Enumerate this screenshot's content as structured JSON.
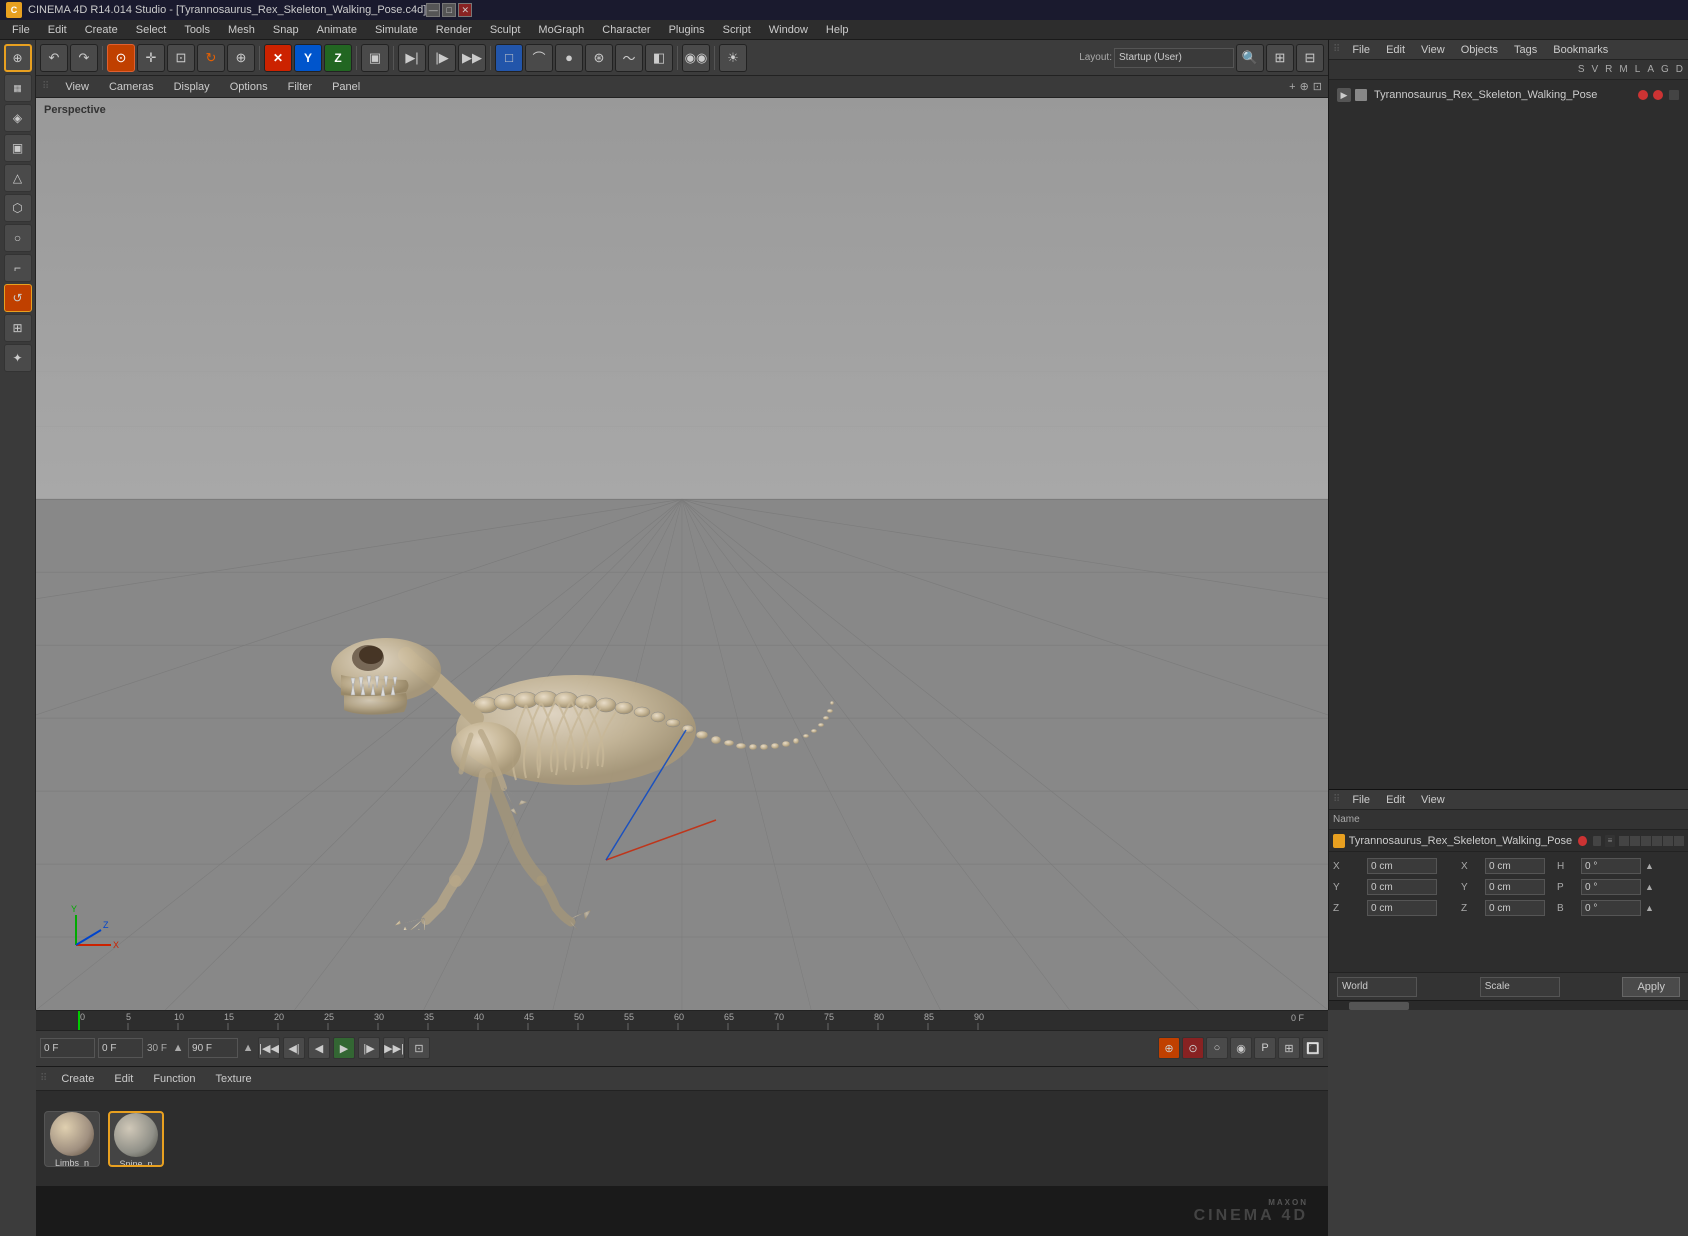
{
  "titlebar": {
    "app_name": "CINEMA 4D R14.014 Studio",
    "file_name": "[Tyrannosaurus_Rex_Skeleton_Walking_Pose.c4d]",
    "title": "CINEMA 4D R14.014 Studio - [Tyrannosaurus_Rex_Skeleton_Walking_Pose.c4d]",
    "controls": [
      "—",
      "□",
      "✕"
    ]
  },
  "menubar": {
    "items": [
      "File",
      "Edit",
      "Create",
      "Select",
      "Tools",
      "Mesh",
      "Snap",
      "Animate",
      "Simulate",
      "Render",
      "Sculpt",
      "MoGraph",
      "Character",
      "Plugins",
      "Script",
      "Window",
      "Help"
    ]
  },
  "viewport": {
    "label": "Perspective",
    "menus": [
      "View",
      "Cameras",
      "Display",
      "Options",
      "Filter",
      "Panel"
    ]
  },
  "timeline": {
    "ticks": [
      "0",
      "5",
      "10",
      "15",
      "20",
      "25",
      "30",
      "35",
      "40",
      "45",
      "50",
      "55",
      "60",
      "65",
      "70",
      "75",
      "80",
      "85",
      "90"
    ],
    "current_frame": "0 F",
    "end_frame": "90 F",
    "fps": "30 F",
    "playback_frame_left": "0 F",
    "playback_frame_right": "0 F"
  },
  "material_editor": {
    "header_menus": [
      "Create",
      "Edit",
      "Function",
      "Texture"
    ],
    "materials": [
      {
        "name": "Limbs_n",
        "selected": false
      },
      {
        "name": "Spine_n",
        "selected": true
      }
    ]
  },
  "maxon_logo": "MAXON CINEMA 4D",
  "right_panel": {
    "obj_manager": {
      "menus": [
        "File",
        "Edit",
        "View",
        "Objects",
        "Tags",
        "Bookmarks"
      ],
      "col_headers": [
        "S",
        "V",
        "R",
        "M",
        "L",
        "A",
        "G",
        "D"
      ],
      "object_name": "Tyrannosaurus_Rex_Skeleton_Walking_Pose"
    },
    "layout": {
      "label": "Layout:",
      "value": "Startup (User)"
    },
    "attr_panel": {
      "menus": [
        "File",
        "Edit",
        "View"
      ],
      "col_name": "Name",
      "object_name": "Tyrannosaurus_Rex_Skeleton_Walking_Pose",
      "coords": {
        "x_pos": "0 cm",
        "y_pos": "0 cm",
        "z_pos": "0 cm",
        "x_rot": "0 °",
        "y_rot": "0 °",
        "z_rot": "0 °",
        "x_size": "0 cm",
        "y_size": "0 cm",
        "z_size": "0 cm",
        "h_rot": "0 °",
        "p_rot": "0 °",
        "b_rot": "0 °"
      },
      "coord_system": "World",
      "coord_mode": "Scale",
      "apply_label": "Apply"
    }
  }
}
